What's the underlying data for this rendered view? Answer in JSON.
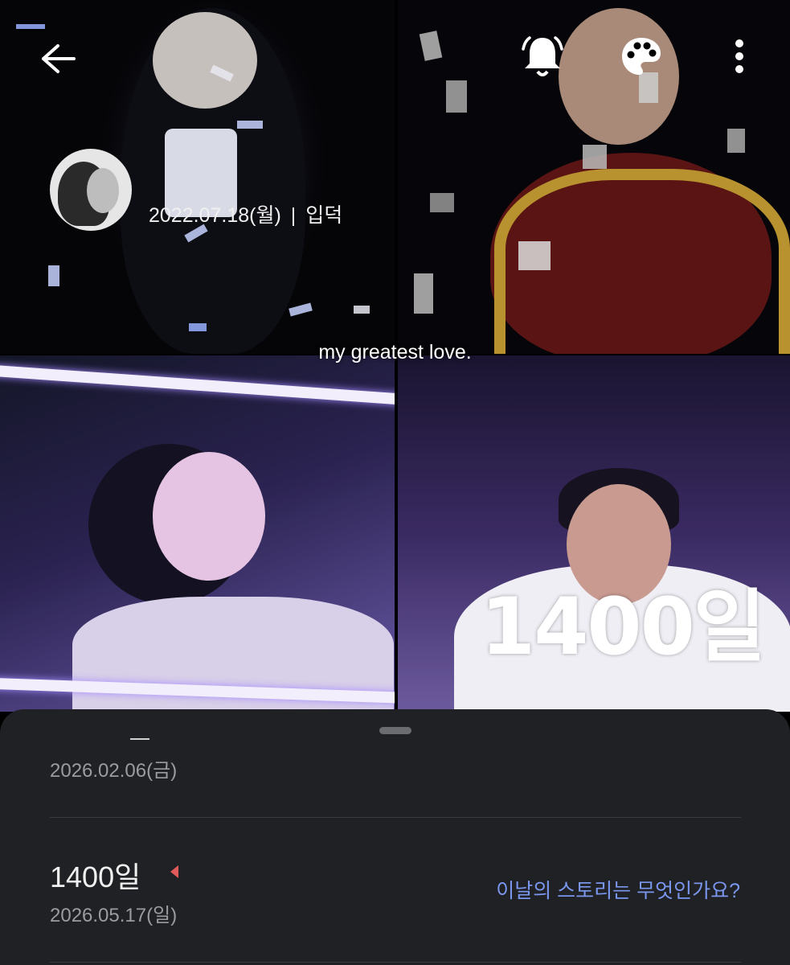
{
  "header": {
    "since_date": "2022.07.18(월)",
    "separator": "|",
    "since_label": "입덕",
    "title": "my greatest love.",
    "big_day": "1400일"
  },
  "icons": {
    "back": "arrow-left-icon",
    "bell": "bell-icon",
    "palette": "palette-icon",
    "more": "more-vertical-icon"
  },
  "sheet": {
    "first_entry": {
      "date": "2026.02.06(금)"
    },
    "milestone": {
      "title": "1400일",
      "date": "2026.05.17(일)",
      "story_prompt": "이날의 스토리는 무엇인가요?"
    }
  },
  "colors": {
    "sheet_bg": "#1f2124",
    "accent_link": "#7b96ee",
    "marker": "#e05a5a",
    "muted_text": "#9a9ca0"
  }
}
